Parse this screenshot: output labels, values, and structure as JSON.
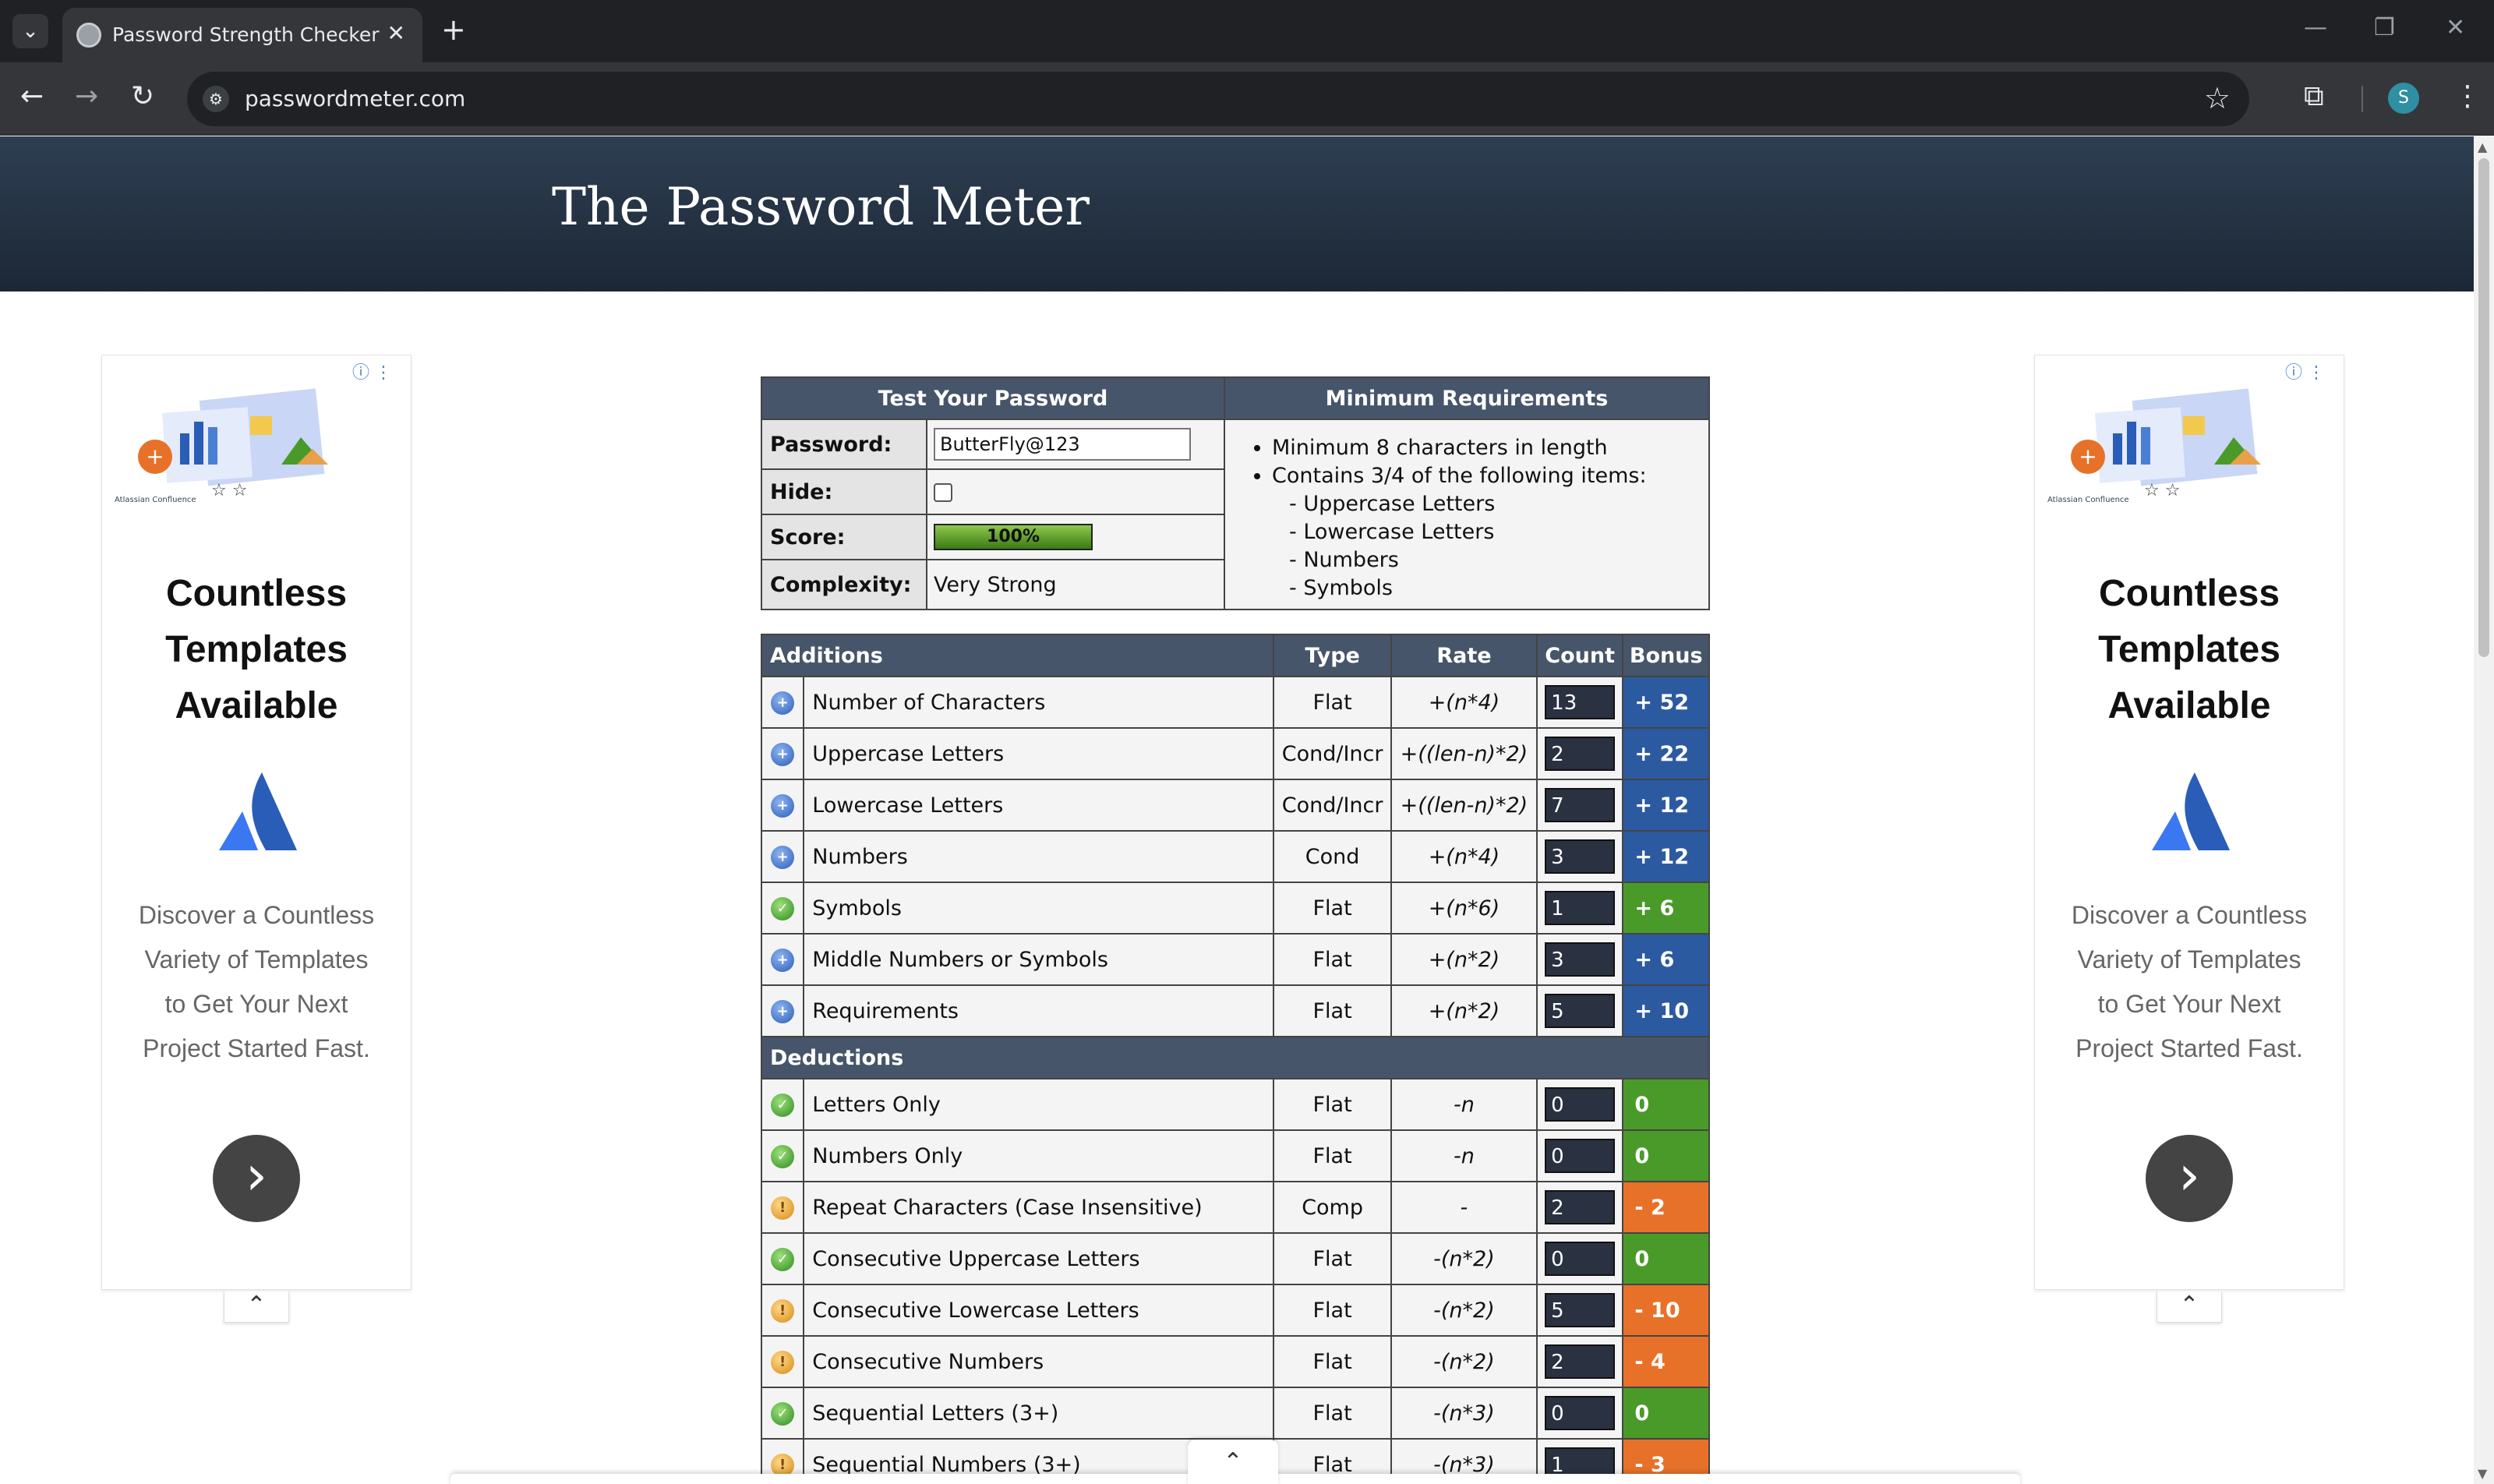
{
  "browser": {
    "tab_title": "Password Strength Checker",
    "url": "passwordmeter.com",
    "profile_initial": "S"
  },
  "site": {
    "title": "The Password Meter"
  },
  "ads": {
    "left": {
      "heading_lines": [
        "Countless",
        "Templates",
        "Available"
      ],
      "text_lines": [
        "Discover a Countless",
        "Variety of Templates",
        "to Get Your Next",
        "Project Started Fast."
      ],
      "brand": "Atlassian Confluence"
    },
    "right": {
      "heading_lines": [
        "Countless",
        "Templates",
        "Available"
      ],
      "text_lines": [
        "Discover a Countless",
        "Variety of Templates",
        "to Get Your Next",
        "Project Started Fast."
      ],
      "brand": "Atlassian Confluence"
    }
  },
  "test": {
    "header": "Test Your Password",
    "password_label": "Password:",
    "password_value": "ButterFly@123",
    "hide_label": "Hide:",
    "score_label": "Score:",
    "score_value": "100%",
    "complexity_label": "Complexity:",
    "complexity_value": "Very Strong"
  },
  "requirements": {
    "header": "Minimum Requirements",
    "items": [
      "Minimum 8 characters in length",
      "Contains 3/4 of the following items:"
    ],
    "sub_items": [
      "- Uppercase Letters",
      "- Lowercase Letters",
      "- Numbers",
      "- Symbols"
    ]
  },
  "columns": {
    "additions": "Additions",
    "type": "Type",
    "rate": "Rate",
    "count": "Count",
    "bonus": "Bonus",
    "deductions": "Deductions"
  },
  "additions": [
    {
      "icon": "plus",
      "name": "Number of Characters",
      "type": "Flat",
      "rate": "+(n*4)",
      "count": "13",
      "bonus": "+ 52",
      "color": "blue"
    },
    {
      "icon": "plus",
      "name": "Uppercase Letters",
      "type": "Cond/Incr",
      "rate": "+((len-n)*2)",
      "count": "2",
      "bonus": "+ 22",
      "color": "blue"
    },
    {
      "icon": "plus",
      "name": "Lowercase Letters",
      "type": "Cond/Incr",
      "rate": "+((len-n)*2)",
      "count": "7",
      "bonus": "+ 12",
      "color": "blue"
    },
    {
      "icon": "plus",
      "name": "Numbers",
      "type": "Cond",
      "rate": "+(n*4)",
      "count": "3",
      "bonus": "+ 12",
      "color": "blue"
    },
    {
      "icon": "check",
      "name": "Symbols",
      "type": "Flat",
      "rate": "+(n*6)",
      "count": "1",
      "bonus": "+ 6",
      "color": "green"
    },
    {
      "icon": "plus",
      "name": "Middle Numbers or Symbols",
      "type": "Flat",
      "rate": "+(n*2)",
      "count": "3",
      "bonus": "+ 6",
      "color": "blue"
    },
    {
      "icon": "plus",
      "name": "Requirements",
      "type": "Flat",
      "rate": "+(n*2)",
      "count": "5",
      "bonus": "+ 10",
      "color": "blue"
    }
  ],
  "deductions": [
    {
      "icon": "check",
      "name": "Letters Only",
      "type": "Flat",
      "rate": "-n",
      "count": "0",
      "bonus": "0",
      "color": "green"
    },
    {
      "icon": "check",
      "name": "Numbers Only",
      "type": "Flat",
      "rate": "-n",
      "count": "0",
      "bonus": "0",
      "color": "green"
    },
    {
      "icon": "warn",
      "name": "Repeat Characters (Case Insensitive)",
      "type": "Comp",
      "rate": "-",
      "count": "2",
      "bonus": "- 2",
      "color": "orange"
    },
    {
      "icon": "check",
      "name": "Consecutive Uppercase Letters",
      "type": "Flat",
      "rate": "-(n*2)",
      "count": "0",
      "bonus": "0",
      "color": "green"
    },
    {
      "icon": "warn",
      "name": "Consecutive Lowercase Letters",
      "type": "Flat",
      "rate": "-(n*2)",
      "count": "5",
      "bonus": "- 10",
      "color": "orange"
    },
    {
      "icon": "warn",
      "name": "Consecutive Numbers",
      "type": "Flat",
      "rate": "-(n*2)",
      "count": "2",
      "bonus": "- 4",
      "color": "orange"
    },
    {
      "icon": "check",
      "name": "Sequential Letters (3+)",
      "type": "Flat",
      "rate": "-(n*3)",
      "count": "0",
      "bonus": "0",
      "color": "green"
    },
    {
      "icon": "warn",
      "name": "Sequential Numbers (3+)",
      "type": "Flat",
      "rate": "-(n*3)",
      "count": "1",
      "bonus": "- 3",
      "color": "orange"
    }
  ],
  "colors": {
    "header": "#465569",
    "blue": "#2c5aa0",
    "green": "#4a9a2a",
    "orange": "#e8712a"
  }
}
